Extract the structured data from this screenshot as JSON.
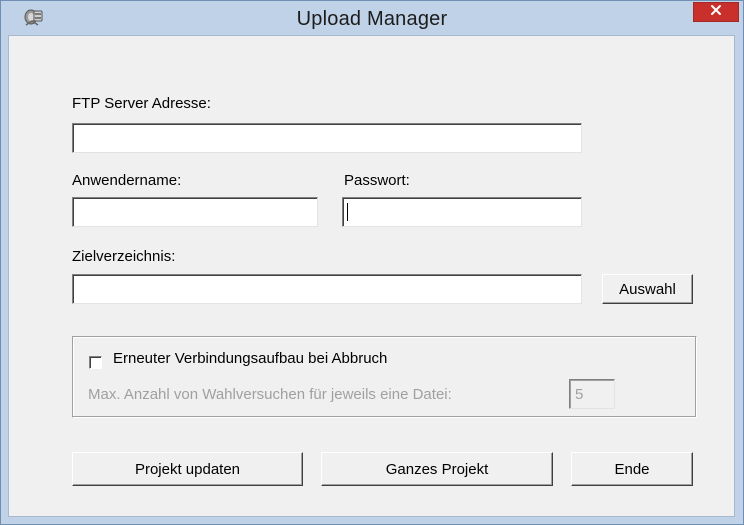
{
  "window": {
    "title": "Upload Manager",
    "icon": "network-drive-icon",
    "close_icon": "close-icon"
  },
  "form": {
    "ftp_label": "FTP Server Adresse:",
    "ftp_value": "",
    "user_label": "Anwendername:",
    "user_value": "",
    "password_label": "Passwort:",
    "password_value": "",
    "target_label": "Zielverzeichnis:",
    "target_value": "",
    "browse_button": "Auswahl"
  },
  "reconnect": {
    "checkbox_label": "Erneuter Verbindungsaufbau bei Abbruch",
    "checked": false,
    "max_attempts_label": "Max. Anzahl von Wahlversuchen für jeweils eine Datei:",
    "max_attempts_value": "5"
  },
  "buttons": {
    "update": "Projekt updaten",
    "full": "Ganzes Projekt",
    "end": "Ende"
  }
}
